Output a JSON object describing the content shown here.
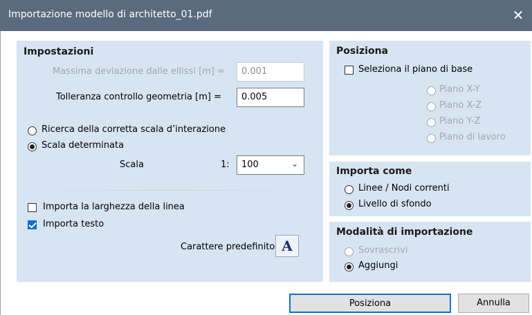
{
  "window": {
    "title": "Importazione modello di architetto_01.pdf",
    "close_glyph": "✕"
  },
  "impostazioni": {
    "title": "Impostazioni",
    "max_dev_label": "Massima deviazione dalle ellissi [m] =",
    "max_dev_value": "0.001",
    "tol_label": "Tolleranza controllo geometria [m] =",
    "tol_value": "0.005",
    "radio_search": "Ricerca della corretta scala d’interazione",
    "radio_determined": "Scala determinata",
    "scale_label": "Scala",
    "scale_prefix": "1:",
    "scale_value": "100",
    "chk_line_width": "Importa la larghezza della linea",
    "chk_line_width_checked": false,
    "chk_text": "Importa testo",
    "chk_text_checked": true,
    "default_font_label": "Carattere predefinito",
    "font_button_glyph": "A"
  },
  "posiziona": {
    "title": "Posiziona",
    "chk_base_plane": "Seleziona il piano di base",
    "options": [
      "Piano X-Y",
      "Piano X-Z",
      "Piano Y-Z",
      "Piano di lavoro"
    ]
  },
  "importa_come": {
    "title": "Importa come",
    "opt_lines": "Linee / Nodi correnti",
    "opt_background": "Livello di sfondo"
  },
  "modalita": {
    "title": "Modalità di importazione",
    "opt_overwrite": "Sovrascrivi",
    "opt_add": "Aggiungi"
  },
  "footer": {
    "position_button": "Posiziona",
    "cancel_button": "Annulla"
  },
  "colors": {
    "titlebar": "#5a6b7e",
    "panel": "#d7e4f2",
    "accent": "#0a6fd1"
  }
}
